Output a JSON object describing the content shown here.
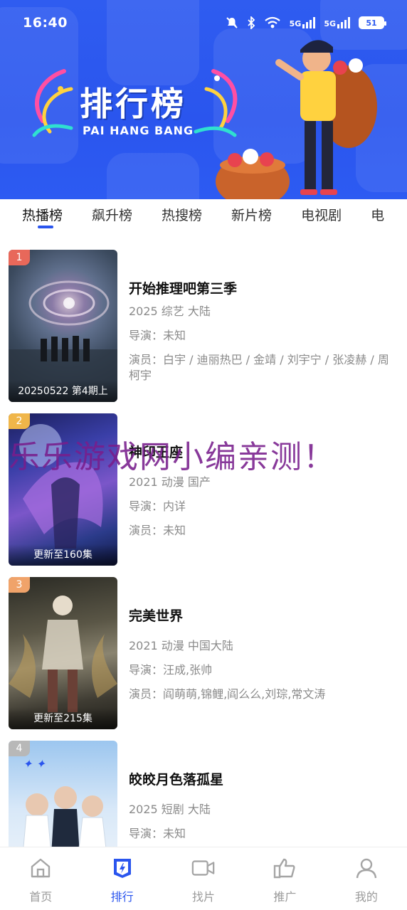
{
  "status_bar": {
    "time": "16:40",
    "network_1": "5G",
    "network_2": "5G",
    "battery": "51"
  },
  "banner": {
    "title": "排行榜",
    "subtitle": "PAI HANG BANG",
    "background_color": "#2f5cf0"
  },
  "tabs": [
    {
      "label": "热播榜",
      "active": true
    },
    {
      "label": "飙升榜",
      "active": false
    },
    {
      "label": "热搜榜",
      "active": false
    },
    {
      "label": "新片榜",
      "active": false
    },
    {
      "label": "电视剧",
      "active": false
    },
    {
      "label": "电",
      "active": false
    }
  ],
  "list": [
    {
      "rank": "1",
      "rank_color": "#e8685a",
      "caption": "20250522 第4期上",
      "title": "开始推理吧第三季",
      "year_genre_region": "2025 综艺 大陆",
      "director": "导演：未知",
      "cast": "演员：白宇 / 迪丽热巴 / 金靖 / 刘宇宁 / 张凌赫 / 周柯宇"
    },
    {
      "rank": "2",
      "rank_color": "#f0b64a",
      "caption": "更新至160集",
      "title": "神印王座",
      "year_genre_region": "2021 动漫 国产",
      "director": "导演：内详",
      "cast": "演员：未知"
    },
    {
      "rank": "3",
      "rank_color": "#f0a36a",
      "caption": "更新至215集",
      "title": "完美世界",
      "year_genre_region": "2021 动漫 中国大陆",
      "director": "导演：汪成,张帅",
      "cast": "演员：阎萌萌,锦鲤,阎么么,刘琮,常文涛"
    },
    {
      "rank": "4",
      "rank_color": "#b8b8b8",
      "caption": "",
      "title": "皎皎月色落孤星",
      "year_genre_region": "2025 短剧 大陆",
      "director": "导演：未知",
      "cast": ""
    }
  ],
  "watermark": "乐乐游戏网小编亲测！",
  "bottom_nav": [
    {
      "label": "首页",
      "icon": "home-icon",
      "active": false
    },
    {
      "label": "排行",
      "icon": "ranking-icon",
      "active": true
    },
    {
      "label": "找片",
      "icon": "video-icon",
      "active": false
    },
    {
      "label": "推广",
      "icon": "thumbs-up-icon",
      "active": false
    },
    {
      "label": "我的",
      "icon": "user-icon",
      "active": false
    }
  ],
  "colors": {
    "accent": "#2a55ee",
    "inactive": "#9a9a9a"
  }
}
